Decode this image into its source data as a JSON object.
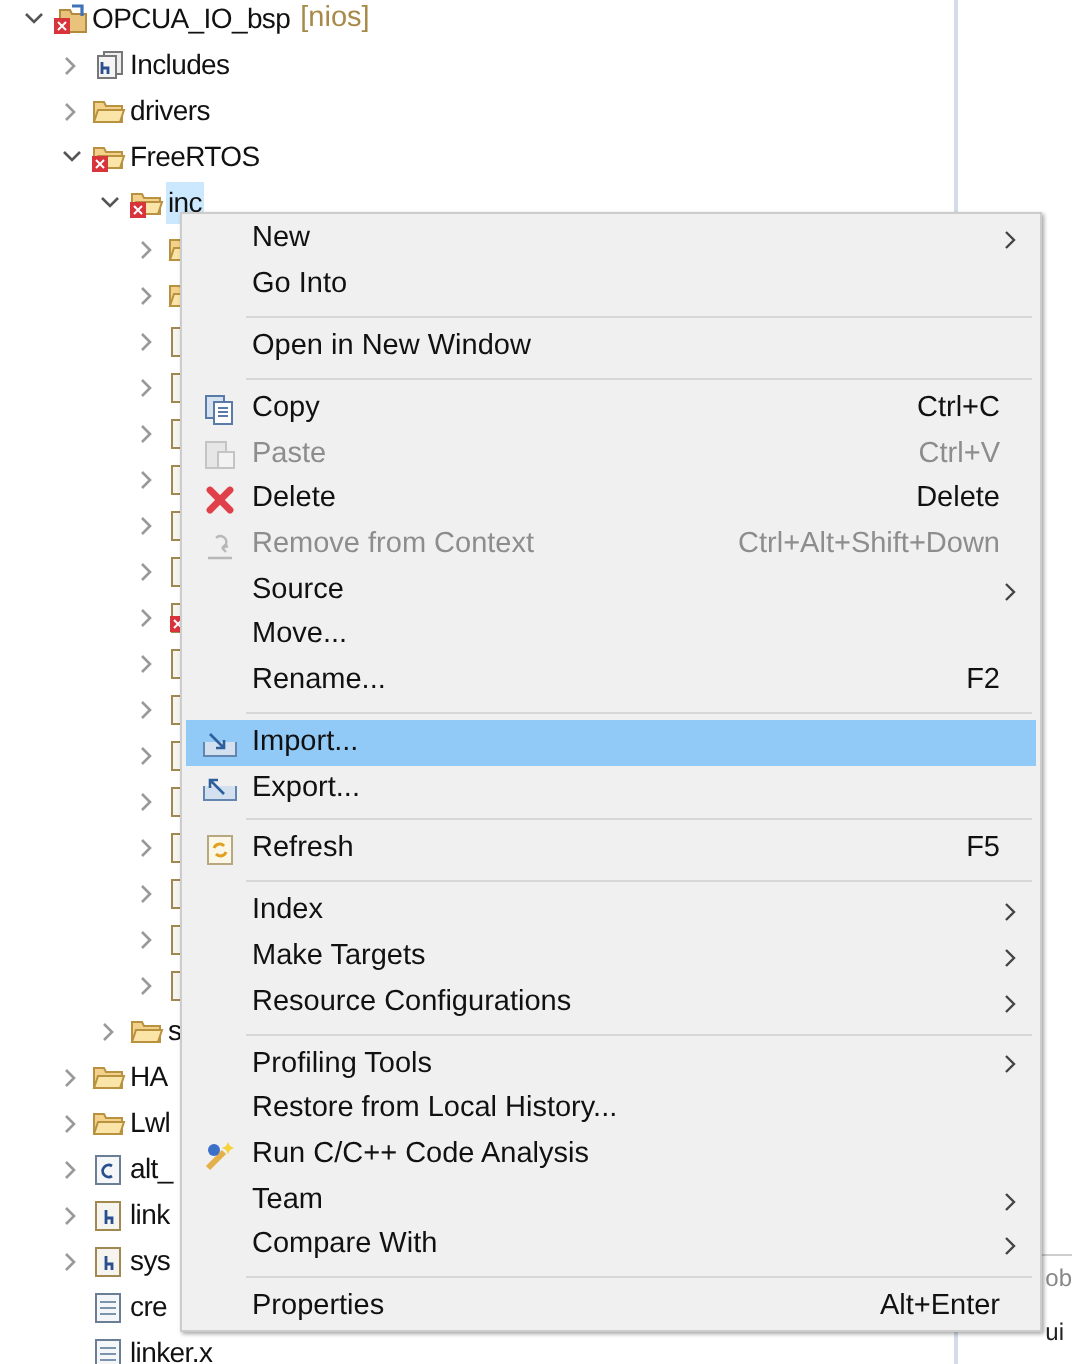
{
  "tree": [
    {
      "label": "OPCUA_IO_bsp",
      "suffix": "[nios]",
      "kind": "project",
      "error": true,
      "expandable": true,
      "expanded": true,
      "selected": false,
      "children": [
        {
          "label": "Includes",
          "kind": "includes",
          "error": false,
          "expandable": true,
          "expanded": false,
          "selected": false
        },
        {
          "label": "drivers",
          "kind": "folder",
          "error": false,
          "expandable": true,
          "expanded": false,
          "selected": false
        },
        {
          "label": "FreeRTOS",
          "kind": "folder",
          "error": true,
          "expandable": true,
          "expanded": true,
          "selected": false,
          "children": [
            {
              "label": "inc",
              "kind": "folder",
              "error": true,
              "expandable": true,
              "expanded": true,
              "selected": true,
              "children": [
                {
                  "kind": "folder",
                  "error": false,
                  "expandable": true,
                  "expanded": false
                },
                {
                  "kind": "folder",
                  "error": false,
                  "expandable": true,
                  "expanded": false
                },
                {
                  "kind": "h_file",
                  "error": false,
                  "expandable": true,
                  "expanded": false
                },
                {
                  "kind": "h_file",
                  "error": false,
                  "expandable": true,
                  "expanded": false
                },
                {
                  "kind": "h_file",
                  "error": false,
                  "expandable": true,
                  "expanded": false
                },
                {
                  "kind": "h_file",
                  "error": false,
                  "expandable": true,
                  "expanded": false
                },
                {
                  "kind": "h_file",
                  "error": false,
                  "expandable": true,
                  "expanded": false
                },
                {
                  "kind": "h_file",
                  "error": false,
                  "expandable": true,
                  "expanded": false
                },
                {
                  "kind": "h_file",
                  "error": true,
                  "expandable": true,
                  "expanded": false
                },
                {
                  "kind": "h_file",
                  "error": false,
                  "expandable": true,
                  "expanded": false
                },
                {
                  "kind": "h_file",
                  "error": false,
                  "expandable": true,
                  "expanded": false
                },
                {
                  "kind": "h_file",
                  "error": false,
                  "expandable": true,
                  "expanded": false
                },
                {
                  "kind": "h_file",
                  "error": false,
                  "expandable": true,
                  "expanded": false
                },
                {
                  "kind": "h_file",
                  "error": false,
                  "expandable": true,
                  "expanded": false
                },
                {
                  "kind": "h_file",
                  "error": false,
                  "expandable": true,
                  "expanded": false
                },
                {
                  "kind": "h_file",
                  "error": false,
                  "expandable": true,
                  "expanded": false
                },
                {
                  "kind": "h_file",
                  "error": false,
                  "expandable": true,
                  "expanded": false
                }
              ]
            },
            {
              "label": "s",
              "kind": "folder",
              "error": false,
              "expandable": true,
              "expanded": false,
              "selected": false
            }
          ]
        },
        {
          "label": "HA",
          "kind": "folder",
          "error": false,
          "expandable": true,
          "expanded": false,
          "selected": false
        },
        {
          "label": "Lwl",
          "kind": "folder",
          "error": false,
          "expandable": true,
          "expanded": false,
          "selected": false
        },
        {
          "label": "alt_",
          "kind": "c_file",
          "error": false,
          "expandable": true,
          "expanded": false,
          "selected": false
        },
        {
          "label": "link",
          "kind": "h_file",
          "error": false,
          "expandable": true,
          "expanded": false,
          "selected": false
        },
        {
          "label": "sys",
          "kind": "h_file",
          "error": false,
          "expandable": true,
          "expanded": false,
          "selected": false
        },
        {
          "label": "cre",
          "kind": "text_file",
          "error": false,
          "expandable": false,
          "expanded": false,
          "selected": false
        },
        {
          "label": "linker.x",
          "kind": "text_file",
          "error": false,
          "expandable": false,
          "expanded": false,
          "selected": false
        }
      ]
    }
  ],
  "side_panel": {
    "lines": [
      "ob",
      "ui"
    ]
  },
  "context_menu": [
    {
      "kind": "item",
      "label": "New",
      "submenu": true,
      "disabled": false,
      "selected": false
    },
    {
      "kind": "item",
      "label": "Go Into",
      "submenu": false,
      "disabled": false,
      "selected": false
    },
    {
      "kind": "separator"
    },
    {
      "kind": "item",
      "label": "Open in New Window",
      "submenu": false,
      "disabled": false,
      "selected": false
    },
    {
      "kind": "separator"
    },
    {
      "kind": "copy",
      "label": "Copy",
      "shortcut": "Ctrl+C",
      "submenu": false,
      "disabled": false,
      "selected": false
    },
    {
      "kind": "paste",
      "label": "Paste",
      "shortcut": "Ctrl+V",
      "submenu": false,
      "disabled": true,
      "selected": false
    },
    {
      "kind": "delete",
      "label": "Delete",
      "shortcut": "Delete",
      "submenu": false,
      "disabled": false,
      "selected": false
    },
    {
      "kind": "remove",
      "label": "Remove from Context",
      "shortcut": "Ctrl+Alt+Shift+Down",
      "submenu": false,
      "disabled": true,
      "selected": false
    },
    {
      "kind": "item",
      "label": "Source",
      "submenu": true,
      "disabled": false,
      "selected": false
    },
    {
      "kind": "item",
      "label": "Move...",
      "submenu": false,
      "disabled": false,
      "selected": false
    },
    {
      "kind": "item",
      "label": "Rename...",
      "shortcut": "F2",
      "submenu": false,
      "disabled": false,
      "selected": false
    },
    {
      "kind": "separator"
    },
    {
      "kind": "import",
      "label": "Import...",
      "submenu": false,
      "disabled": false,
      "selected": true
    },
    {
      "kind": "export",
      "label": "Export...",
      "submenu": false,
      "disabled": false,
      "selected": false
    },
    {
      "kind": "separator"
    },
    {
      "kind": "refresh",
      "label": "Refresh",
      "shortcut": "F5",
      "submenu": false,
      "disabled": false,
      "selected": false
    },
    {
      "kind": "separator"
    },
    {
      "kind": "item",
      "label": "Index",
      "submenu": true,
      "disabled": false,
      "selected": false
    },
    {
      "kind": "item",
      "label": "Make Targets",
      "submenu": true,
      "disabled": false,
      "selected": false
    },
    {
      "kind": "item",
      "label": "Resource Configurations",
      "submenu": true,
      "disabled": false,
      "selected": false
    },
    {
      "kind": "separator"
    },
    {
      "kind": "item",
      "label": "Profiling Tools",
      "submenu": true,
      "disabled": false,
      "selected": false
    },
    {
      "kind": "item",
      "label": "Restore from Local History...",
      "submenu": false,
      "disabled": false,
      "selected": false
    },
    {
      "kind": "analysis",
      "label": "Run C/C++ Code Analysis",
      "submenu": false,
      "disabled": false,
      "selected": false
    },
    {
      "kind": "item",
      "label": "Team",
      "submenu": true,
      "disabled": false,
      "selected": false
    },
    {
      "kind": "item",
      "label": "Compare With",
      "submenu": true,
      "disabled": false,
      "selected": false
    },
    {
      "kind": "separator"
    },
    {
      "kind": "item",
      "label": "Properties",
      "shortcut": "Alt+Enter",
      "submenu": false,
      "disabled": false,
      "selected": false
    }
  ]
}
